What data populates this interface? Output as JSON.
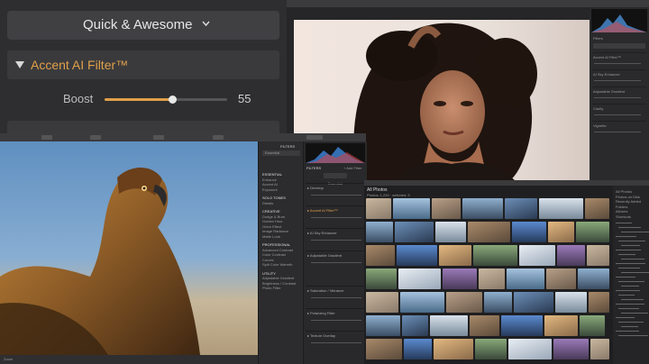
{
  "big_panel": {
    "preset_title": "Quick & Awesome",
    "filter_name": "Accent AI Filter™",
    "slider_label": "Boost",
    "slider_value": "55",
    "slider_fraction": 0.55,
    "accent_color": "#e0a04a"
  },
  "portrait_window": {
    "right_panel": {
      "section_header": "Filters",
      "items": [
        "Accent AI Filter™",
        "AI Sky Enhancer",
        "Adjustable Gradient",
        "Clarity",
        "Vignette"
      ]
    }
  },
  "eagle_window": {
    "catalog_title": "FILTERS CATALOG",
    "catalog_filter": "Essential",
    "groups": [
      {
        "title": "ESSENTIAL",
        "items": [
          "Enhance",
          "Accent AI",
          "Exposure"
        ]
      },
      {
        "title": "SOLO TONES",
        "items": [
          "Details"
        ]
      },
      {
        "title": "CREATIVE",
        "items": [
          "Dodge & Burn",
          "Golden Hour",
          "Orton Effect",
          "Image Radiance",
          "Matte Look"
        ]
      },
      {
        "title": "PROFESSIONAL",
        "items": [
          "Advanced Contrast",
          "Color Contrast",
          "Curves",
          "Split Color Warmth"
        ]
      },
      {
        "title": "UTILITY",
        "items": [
          "Adjustable Gradient",
          "Brightness / Contrast",
          "Photo Filter"
        ]
      }
    ],
    "filters_header": "FILTERS",
    "filters_tab": "Essential",
    "add_filter": "+ Add Filter",
    "sections": [
      "Develop",
      "Accent AI Filter™",
      "AI Sky Enhancer",
      "Adjustable Gradient",
      "Saturation / Vibrance",
      "Polarizing Filter",
      "Texture Overlay"
    ],
    "bottom_label": "Zoom"
  },
  "library_window": {
    "title": "All Photos",
    "subtitle": "Photos: 1,220 · selected: 3",
    "sidebar_items": [
      "All Photos",
      "Photos on Disk",
      "Recently Added",
      "Folders",
      "Albums",
      "Shortcuts"
    ]
  }
}
